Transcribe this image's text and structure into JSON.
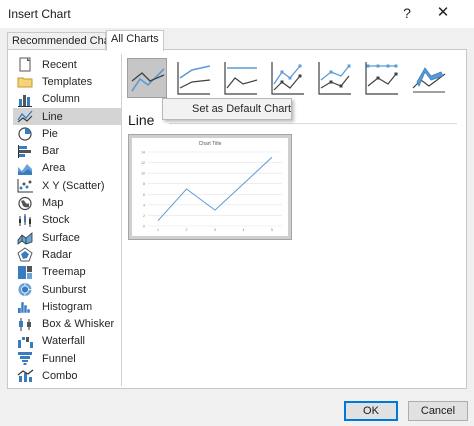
{
  "window": {
    "title": "Insert Chart",
    "help_glyph": "?",
    "close_glyph": "✕"
  },
  "tabs": [
    {
      "label": "Recommended Charts",
      "active": false
    },
    {
      "label": "All Charts",
      "active": true
    }
  ],
  "chart_types": [
    {
      "label": "Recent",
      "icon": "recent-icon"
    },
    {
      "label": "Templates",
      "icon": "templates-icon"
    },
    {
      "label": "Column",
      "icon": "column-chart-icon"
    },
    {
      "label": "Line",
      "icon": "line-chart-icon",
      "selected": true
    },
    {
      "label": "Pie",
      "icon": "pie-chart-icon"
    },
    {
      "label": "Bar",
      "icon": "bar-chart-icon"
    },
    {
      "label": "Area",
      "icon": "area-chart-icon"
    },
    {
      "label": "X Y (Scatter)",
      "icon": "scatter-chart-icon"
    },
    {
      "label": "Map",
      "icon": "map-chart-icon"
    },
    {
      "label": "Stock",
      "icon": "stock-chart-icon"
    },
    {
      "label": "Surface",
      "icon": "surface-chart-icon"
    },
    {
      "label": "Radar",
      "icon": "radar-chart-icon"
    },
    {
      "label": "Treemap",
      "icon": "treemap-chart-icon"
    },
    {
      "label": "Sunburst",
      "icon": "sunburst-chart-icon"
    },
    {
      "label": "Histogram",
      "icon": "histogram-chart-icon"
    },
    {
      "label": "Box & Whisker",
      "icon": "box-whisker-chart-icon"
    },
    {
      "label": "Waterfall",
      "icon": "waterfall-chart-icon"
    },
    {
      "label": "Funnel",
      "icon": "funnel-chart-icon"
    },
    {
      "label": "Combo",
      "icon": "combo-chart-icon"
    }
  ],
  "subtypes": [
    {
      "icon": "line-subtype-icon",
      "selected": true
    },
    {
      "icon": "stacked-line-subtype-icon"
    },
    {
      "icon": "percent-stacked-line-subtype-icon"
    },
    {
      "icon": "line-markers-subtype-icon"
    },
    {
      "icon": "stacked-line-markers-subtype-icon"
    },
    {
      "icon": "percent-stacked-line-markers-subtype-icon"
    },
    {
      "icon": "3d-line-subtype-icon"
    }
  ],
  "tooltip": {
    "text": "Set as Default Chart"
  },
  "selected_type_title": "Line",
  "preview": {
    "chart_title": "Chart Title",
    "line_color": "#5b9bd5",
    "y_ticks": [
      "0",
      "2",
      "4",
      "6",
      "8",
      "10",
      "12",
      "14"
    ],
    "x_ticks": [
      "1",
      "2",
      "3",
      "4",
      "5"
    ],
    "values": [
      1,
      7,
      3,
      8,
      13
    ],
    "ylim": [
      0,
      14
    ]
  },
  "buttons": {
    "ok": "OK",
    "cancel": "Cancel"
  },
  "colors": {
    "accent": "#0078d7",
    "selection": "#d4d4d4",
    "series_blue": "#5b9bd5",
    "series_dark": "#404040"
  }
}
